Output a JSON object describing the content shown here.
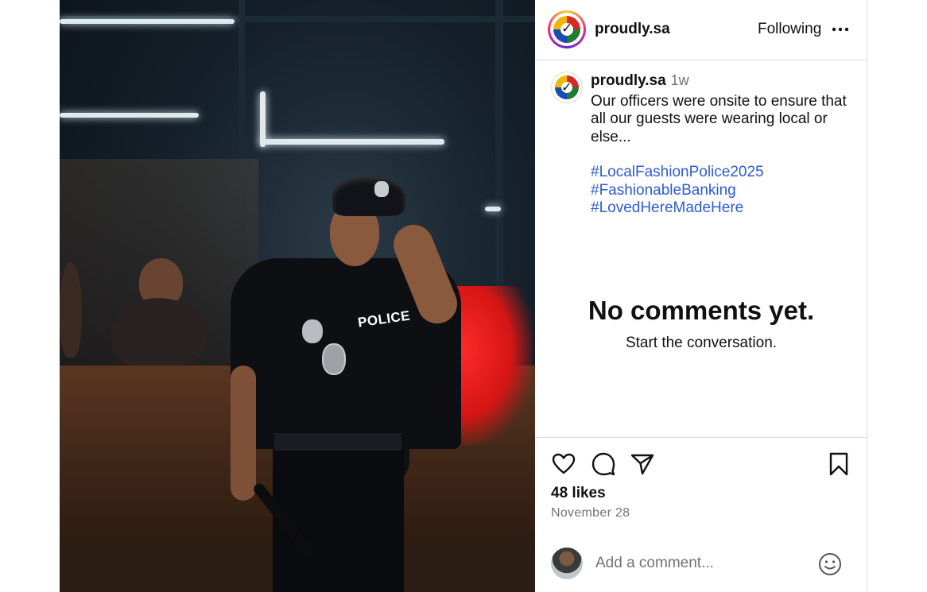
{
  "post": {
    "author": "proudly.sa",
    "follow_status": "Following",
    "photo_text": "POLICE"
  },
  "caption": {
    "author": "proudly.sa",
    "time_ago": "1w",
    "text": "Our officers were onsite to ensure that all our guests were wearing local or else...",
    "hashtags": [
      "#LocalFashionPolice2025",
      "#FashionableBanking",
      "#LovedHereMadeHere"
    ]
  },
  "comments": {
    "empty_title": "No comments yet.",
    "empty_subtitle": "Start the conversation."
  },
  "stats": {
    "likes": "48 likes",
    "date": "November 28"
  },
  "comment_box": {
    "placeholder": "Add a comment..."
  },
  "icons": {
    "more": "more-horizontal-icon",
    "like": "heart-icon",
    "comment": "comment-bubble-icon",
    "share": "paper-plane-icon",
    "save": "bookmark-icon",
    "emoji": "smiley-icon"
  },
  "colors": {
    "hashtag": "#2f5bd3",
    "muted": "#737373",
    "divider": "#dbdbdb"
  }
}
